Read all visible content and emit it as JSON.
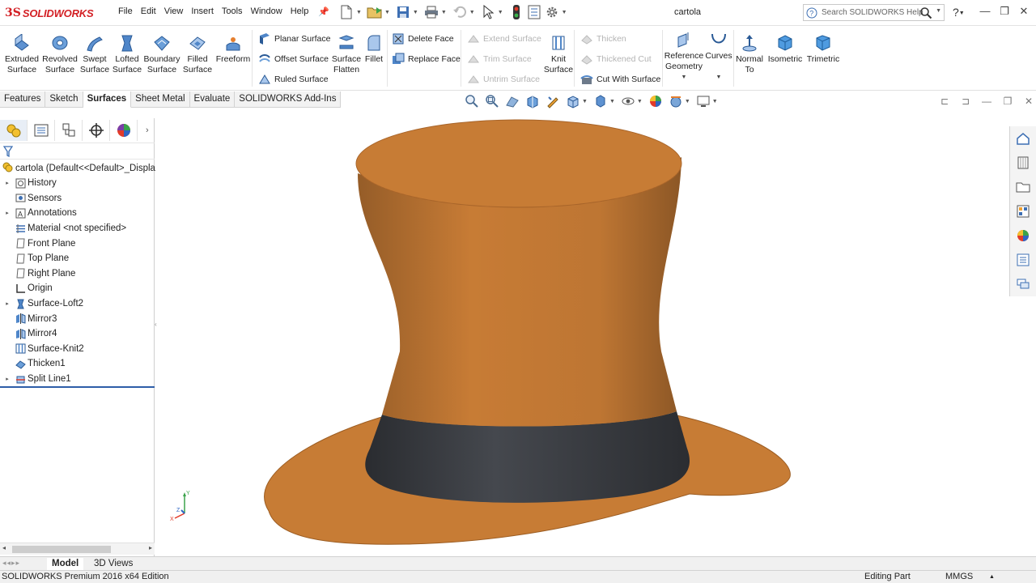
{
  "app": {
    "logo_ds": "3S",
    "logo_text": "SOLIDWORKS",
    "document_title": "cartola"
  },
  "menu": [
    "File",
    "Edit",
    "View",
    "Insert",
    "Tools",
    "Window",
    "Help"
  ],
  "search": {
    "placeholder": "Search SOLIDWORKS Help"
  },
  "ribbon": {
    "big_buttons": [
      {
        "label1": "Extruded",
        "label2": "Surface",
        "icon": "extruded-surface-icon"
      },
      {
        "label1": "Revolved",
        "label2": "Surface",
        "icon": "revolved-surface-icon"
      },
      {
        "label1": "Swept",
        "label2": "Surface",
        "icon": "swept-surface-icon"
      },
      {
        "label1": "Lofted",
        "label2": "Surface",
        "icon": "lofted-surface-icon"
      },
      {
        "label1": "Boundary",
        "label2": "Surface",
        "icon": "boundary-surface-icon"
      },
      {
        "label1": "Filled",
        "label2": "Surface",
        "icon": "filled-surface-icon"
      },
      {
        "label1": "Freeform",
        "label2": "",
        "icon": "freeform-icon"
      }
    ],
    "surface_small": [
      {
        "label": "Planar Surface",
        "icon": "planar-surface-icon",
        "enabled": true
      },
      {
        "label": "Offset Surface",
        "icon": "offset-surface-icon",
        "enabled": true
      },
      {
        "label": "Ruled Surface",
        "icon": "ruled-surface-icon",
        "enabled": true
      }
    ],
    "flatten": {
      "label1": "Surface",
      "label2": "Flatten"
    },
    "fillet": {
      "label1": "Fillet"
    },
    "face_small": [
      {
        "label": "Delete Face",
        "icon": "delete-face-icon",
        "enabled": true
      },
      {
        "label": "Replace Face",
        "icon": "replace-face-icon",
        "enabled": true
      }
    ],
    "trim_small": [
      {
        "label": "Extend Surface",
        "enabled": false
      },
      {
        "label": "Trim Surface",
        "enabled": false
      },
      {
        "label": "Untrim Surface",
        "enabled": false
      }
    ],
    "knit": {
      "label1": "Knit",
      "label2": "Surface"
    },
    "thicken_small": [
      {
        "label": "Thicken",
        "enabled": false
      },
      {
        "label": "Thickened Cut",
        "enabled": false
      },
      {
        "label": "Cut With Surface",
        "enabled": true
      }
    ],
    "ref_geometry": {
      "label1": "Reference",
      "label2": "Geometry"
    },
    "curves": {
      "label1": "Curves"
    },
    "normal_to": {
      "label1": "Normal",
      "label2": "To"
    },
    "isometric": {
      "label1": "Isometric"
    },
    "trimetric": {
      "label1": "Trimetric"
    }
  },
  "tabs": [
    "Features",
    "Sketch",
    "Surfaces",
    "Sheet Metal",
    "Evaluate",
    "SOLIDWORKS Add-Ins"
  ],
  "active_tab": "Surfaces",
  "feature_tree": {
    "root": "cartola  (Default<<Default>_Displa",
    "items": [
      {
        "label": "History",
        "icon": "history-folder-icon",
        "expandable": true
      },
      {
        "label": "Sensors",
        "icon": "sensors-icon",
        "expandable": false
      },
      {
        "label": "Annotations",
        "icon": "annotations-icon",
        "expandable": true
      },
      {
        "label": "Material <not specified>",
        "icon": "material-icon",
        "expandable": false
      },
      {
        "label": "Front Plane",
        "icon": "plane-icon",
        "expandable": false
      },
      {
        "label": "Top Plane",
        "icon": "plane-icon",
        "expandable": false
      },
      {
        "label": "Right Plane",
        "icon": "plane-icon",
        "expandable": false
      },
      {
        "label": "Origin",
        "icon": "origin-icon",
        "expandable": false
      },
      {
        "label": "Surface-Loft2",
        "icon": "loft-feature-icon",
        "expandable": true
      },
      {
        "label": "Mirror3",
        "icon": "mirror-feature-icon",
        "expandable": false
      },
      {
        "label": "Mirror4",
        "icon": "mirror-feature-icon",
        "expandable": false
      },
      {
        "label": "Surface-Knit2",
        "icon": "knit-feature-icon",
        "expandable": false
      },
      {
        "label": "Thicken1",
        "icon": "thicken-feature-icon",
        "expandable": false
      },
      {
        "label": "Split Line1",
        "icon": "split-line-icon",
        "expandable": true
      }
    ]
  },
  "bottom_tabs": [
    "Model",
    "3D Views"
  ],
  "status": {
    "edition": "SOLIDWORKS Premium 2016 x64 Edition",
    "mode": "Editing Part",
    "units": "MMGS"
  },
  "colors": {
    "hat_orange": "#c77a33",
    "hat_band": "#3a3c40",
    "accent": "#2e5ea8",
    "logo_red": "#d31f24"
  }
}
